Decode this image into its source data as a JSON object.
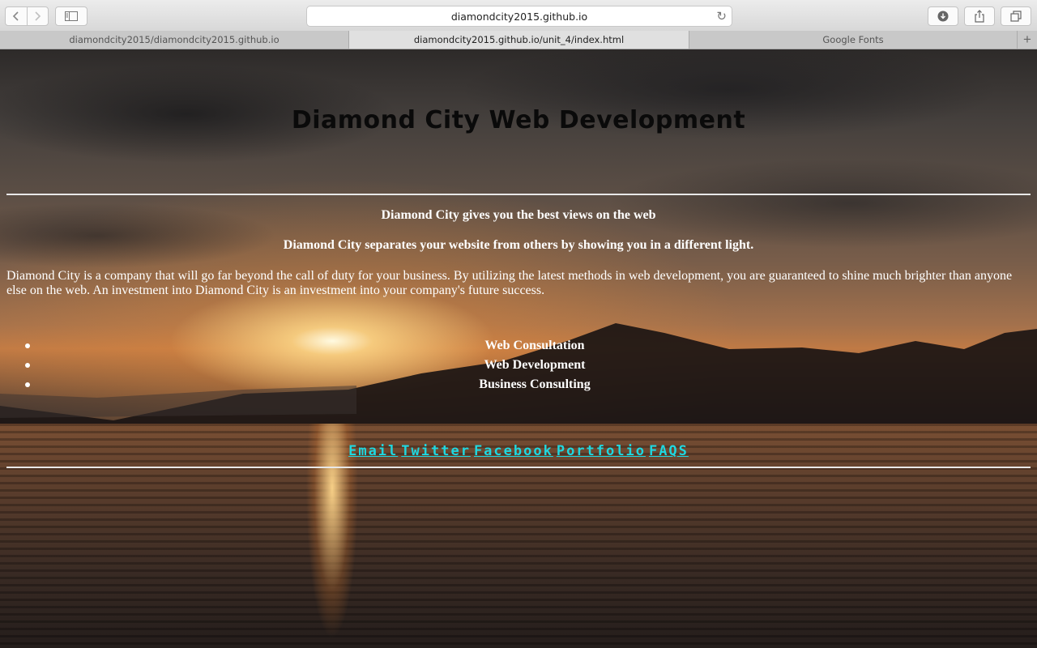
{
  "browser": {
    "url": "diamondcity2015.github.io",
    "tabs": [
      {
        "label": "diamondcity2015/diamondcity2015.github.io",
        "active": false
      },
      {
        "label": "diamondcity2015.github.io/unit_4/index.html",
        "active": true
      },
      {
        "label": "Google Fonts",
        "active": false
      }
    ],
    "icons": {
      "back": "chevron-left-icon",
      "forward": "chevron-right-icon",
      "sidebar": "sidebar-icon",
      "reload": "reload-icon",
      "download": "download-icon",
      "share": "share-icon",
      "tabs_overview": "tabs-overview-icon",
      "new_tab": "plus-icon"
    }
  },
  "page": {
    "title": "Diamond City Web Development",
    "tagline1": "Diamond City gives you the best views on the web",
    "tagline2": "Diamond City separates your website from others by showing you in a different light.",
    "paragraph": "Diamond City is a company that will go far beyond the call of duty for your business. By utilizing the latest methods in web development, you are guaranteed to shine much brighter than anyone else on the web. An investment into Diamond City is an investment into your company's future success.",
    "services": [
      "Web Consultation",
      "Web Development",
      "Business Consulting"
    ],
    "links": [
      "Email",
      "Twitter",
      "Facebook",
      "Portfolio",
      "FAQS"
    ],
    "colors": {
      "title": "#0a0a0a",
      "text": "#ffffff",
      "link": "#1fd7e0"
    }
  }
}
